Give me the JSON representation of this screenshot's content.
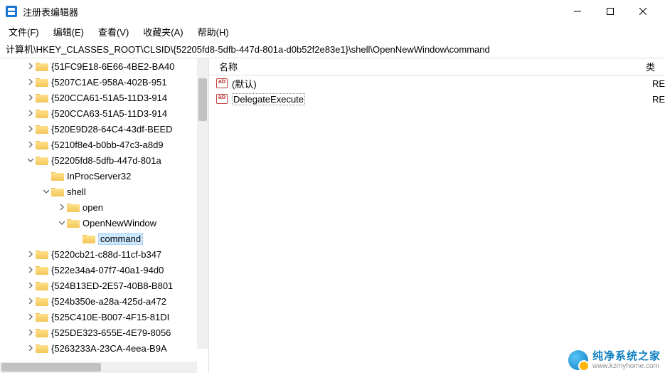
{
  "window": {
    "title": "注册表编辑器"
  },
  "menu": {
    "file": "文件(F)",
    "edit": "编辑(E)",
    "view": "查看(V)",
    "favorites": "收藏夹(A)",
    "help": "帮助(H)"
  },
  "address": {
    "path": "计算机\\HKEY_CLASSES_ROOT\\CLSID\\{52205fd8-5dfb-447d-801a-d0b52f2e83e1}\\shell\\OpenNewWindow\\command"
  },
  "tree": {
    "items": [
      {
        "label": "{51FC9E18-6E66-4BE2-BA40",
        "indent": 1,
        "chev": "right"
      },
      {
        "label": "{5207C1AE-958A-402B-951",
        "indent": 1,
        "chev": "right"
      },
      {
        "label": "{520CCA61-51A5-11D3-914",
        "indent": 1,
        "chev": "right"
      },
      {
        "label": "{520CCA63-51A5-11D3-914",
        "indent": 1,
        "chev": "right"
      },
      {
        "label": "{520E9D28-64C4-43df-BEED",
        "indent": 1,
        "chev": "right"
      },
      {
        "label": "{5210f8e4-b0bb-47c3-a8d9",
        "indent": 1,
        "chev": "right"
      },
      {
        "label": "{52205fd8-5dfb-447d-801a",
        "indent": 1,
        "chev": "down"
      },
      {
        "label": "InProcServer32",
        "indent": 2,
        "chev": "none"
      },
      {
        "label": "shell",
        "indent": 2,
        "chev": "down"
      },
      {
        "label": "open",
        "indent": 3,
        "chev": "right"
      },
      {
        "label": "OpenNewWindow",
        "indent": 3,
        "chev": "down"
      },
      {
        "label": "command",
        "indent": 4,
        "chev": "none",
        "selected": true
      },
      {
        "label": "{5220cb21-c88d-11cf-b347",
        "indent": 1,
        "chev": "right"
      },
      {
        "label": "{522e34a4-07f7-40a1-94d0",
        "indent": 1,
        "chev": "right"
      },
      {
        "label": "{524B13ED-2E57-40B8-B801",
        "indent": 1,
        "chev": "right"
      },
      {
        "label": "{524b350e-a28a-425d-a472",
        "indent": 1,
        "chev": "right"
      },
      {
        "label": "{525C410E-B007-4F15-81DI",
        "indent": 1,
        "chev": "right"
      },
      {
        "label": "{525DE323-655E-4E79-8056",
        "indent": 1,
        "chev": "right"
      },
      {
        "label": "{5263233A-23CA-4eea-B9A",
        "indent": 1,
        "chev": "right"
      }
    ]
  },
  "list": {
    "header": {
      "name": "名称",
      "type_partial": "类",
      "re_partial": "RE"
    },
    "rows": [
      {
        "name": "(默认)"
      },
      {
        "name": "DelegateExecute",
        "selected": true
      }
    ]
  },
  "watermark": {
    "cn": "纯净系统之家",
    "url": "www.kzmyhome.com"
  }
}
